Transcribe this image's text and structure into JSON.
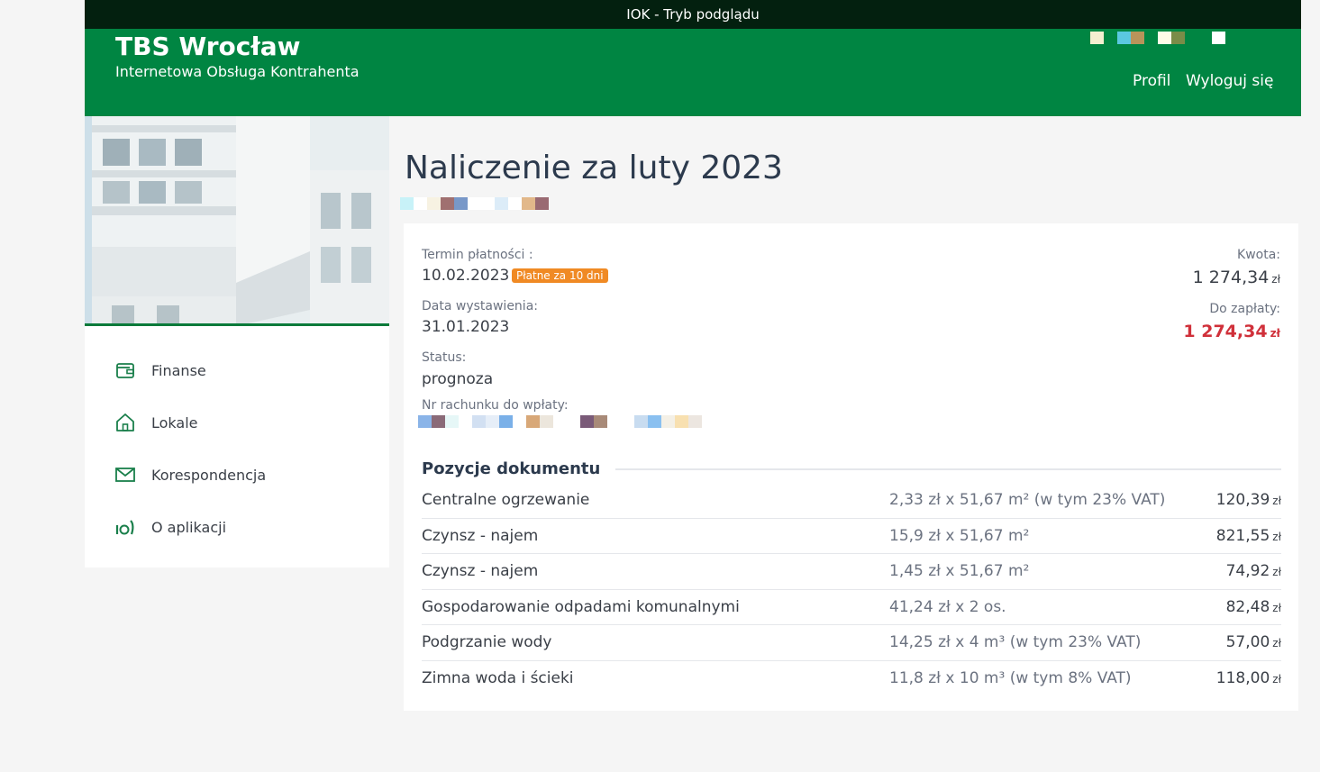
{
  "topbar": {
    "text": "IOK - Tryb podglądu"
  },
  "header": {
    "title": "TBS Wrocław",
    "subtitle": "Internetowa Obsługa Kontrahenta",
    "nav": {
      "profile": "Profil",
      "logout": "Wyloguj się"
    },
    "pixel_colors": [
      "#f4efd0",
      "#008542",
      "#5bc8e0",
      "#b8945a",
      "#008542",
      "#fffce8",
      "#7a8c48",
      "#008542",
      "#008542",
      "#ffffff"
    ]
  },
  "sidebar": {
    "menu": [
      {
        "label": "Finanse",
        "icon": "wallet-icon"
      },
      {
        "label": "Lokale",
        "icon": "home-icon"
      },
      {
        "label": "Korespondencja",
        "icon": "envelope-icon"
      },
      {
        "label": "O aplikacji",
        "icon": "app-info-icon"
      }
    ]
  },
  "main": {
    "title": "Naliczenie za luty 2023",
    "title_pixel_colors": [
      "#c8f2f8",
      "#ffffff",
      "#f7f2e2",
      "#a07070",
      "#7898c8",
      "#ffffff",
      "#ffffff",
      "#dcecf8",
      "#ffffff",
      "#e2b88a",
      "#9a6a72"
    ],
    "details": {
      "due_label": "Termin płatności :",
      "due_value": "10.02.2023",
      "due_badge": "Płatne za 10 dni",
      "issue_label": "Data wystawienia:",
      "issue_value": "31.01.2023",
      "status_label": "Status:",
      "status_value": "prognoza",
      "account_label": "Nr rachunku do wpłaty:",
      "account_pixel_colors": [
        "#8ab4e8",
        "#8a6a78",
        "#e6f7f7",
        "#ffffff",
        "#d2e0f2",
        "#e6eef8",
        "#7ab0e8",
        "#ffffff",
        "#d8a878",
        "#ece6dc",
        "#ffffff",
        "#ffffff",
        "#7a5a78",
        "#a88a78",
        "#ffffff",
        "#ffffff",
        "#c8dcf0",
        "#8ac0f0",
        "#f4f0e6",
        "#f8e0b0",
        "#ece6e0"
      ],
      "amount_label": "Kwota:",
      "amount_value": "1 274,34",
      "due_amount_label": "Do zapłaty:",
      "due_amount_value": "1 274,34",
      "currency": "zł"
    },
    "positions_title": "Pozycje dokumentu",
    "positions": [
      {
        "name": "Centralne ogrzewanie",
        "calc": "2,33 zł x 51,67 m² (w tym 23% VAT)",
        "amount": "120,39"
      },
      {
        "name": "Czynsz - najem",
        "calc": "15,9 zł x 51,67 m²",
        "amount": "821,55"
      },
      {
        "name": "Czynsz - najem",
        "calc": "1,45 zł x 51,67 m²",
        "amount": "74,92"
      },
      {
        "name": "Gospodarowanie odpadami komunalnymi",
        "calc": "41,24 zł x 2 os.",
        "amount": "82,48"
      },
      {
        "name": "Podgrzanie wody",
        "calc": "14,25 zł x 4 m³ (w tym 23% VAT)",
        "amount": "57,00"
      },
      {
        "name": "Zimna woda i ścieki",
        "calc": "11,8 zł x 10 m³ (w tym 8% VAT)",
        "amount": "118,00"
      }
    ]
  }
}
